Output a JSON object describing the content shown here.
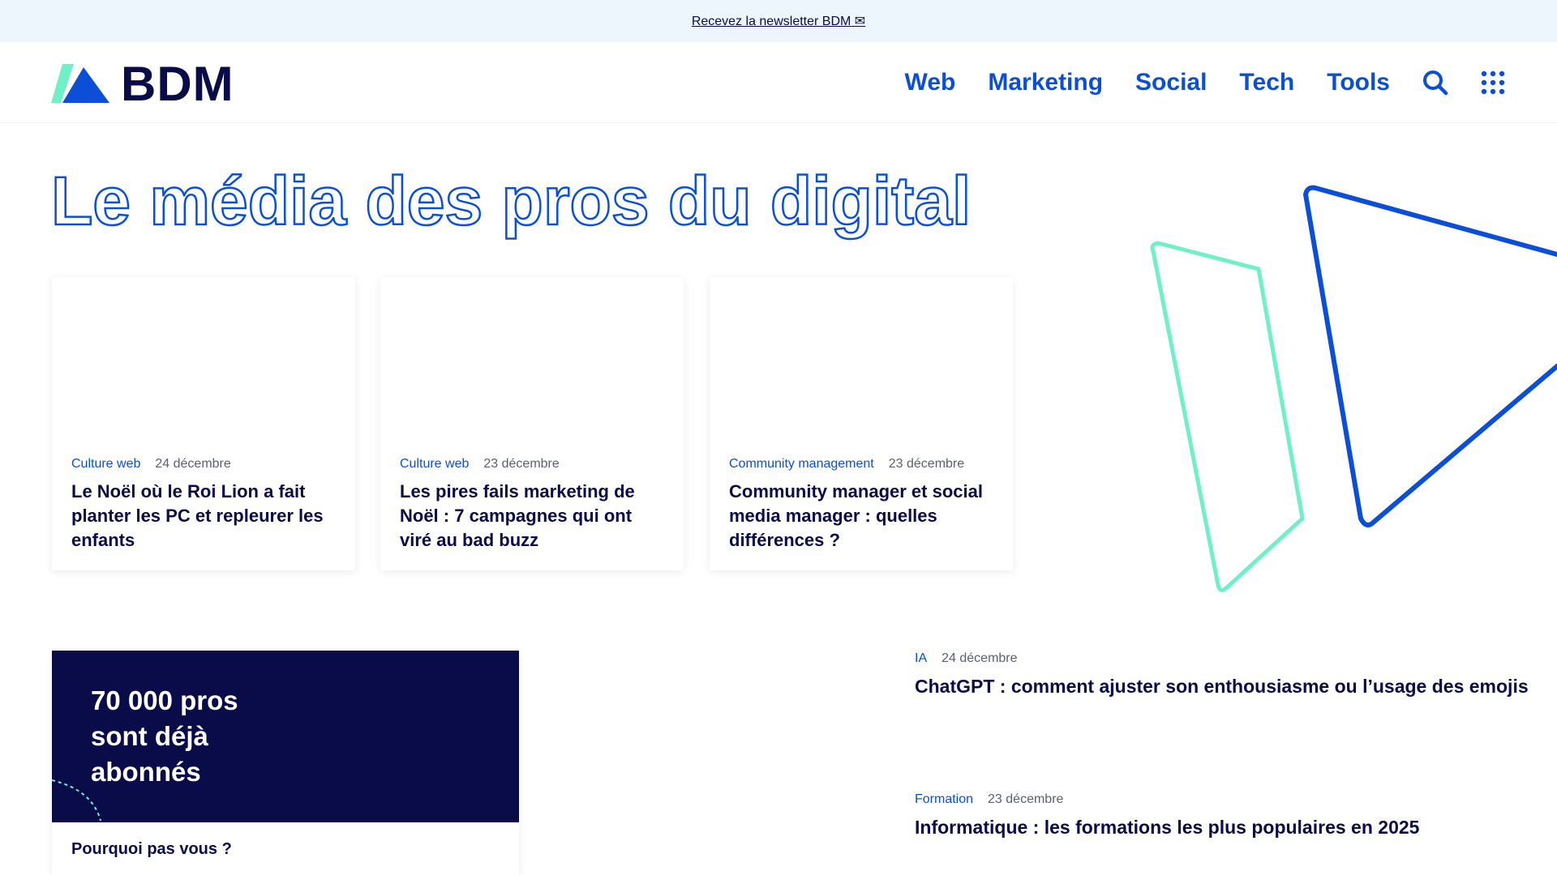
{
  "topbar": {
    "newsletter_link": "Recevez la newsletter BDM ✉"
  },
  "brand": {
    "name": "BDM",
    "colors": {
      "navy": "#0a0c4a",
      "blue": "#0b4fd9",
      "mint": "#6ff0c7"
    }
  },
  "nav": {
    "items": [
      {
        "label": "Web"
      },
      {
        "label": "Marketing"
      },
      {
        "label": "Social"
      },
      {
        "label": "Tech"
      },
      {
        "label": "Tools"
      }
    ],
    "icons": [
      "search-icon",
      "apps-grid-icon"
    ]
  },
  "hero": {
    "title": "Le média des pros du digital"
  },
  "cards": [
    {
      "category": "Culture web",
      "date": "24 décembre",
      "title": "Le Noël où le Roi Lion a fait planter les PC et repleurer les enfants"
    },
    {
      "category": "Culture web",
      "date": "23 décembre",
      "title": "Les pires fails marketing de Noël : 7 campagnes qui ont viré au bad buzz"
    },
    {
      "category": "Community management",
      "date": "23 décembre",
      "title": "Community manager et social media manager : quelles différences ?"
    }
  ],
  "promo": {
    "title": "70 000 pros sont déjà abonnés",
    "subtitle": "Pourquoi pas vous ?"
  },
  "side_articles": [
    {
      "category": "IA",
      "date": "24 décembre",
      "title": "ChatGPT : comment ajuster son enthousiasme ou l’usage des emojis"
    },
    {
      "category": "Formation",
      "date": "23 décembre",
      "title": "Informatique : les formations les plus populaires en 2025"
    }
  ]
}
